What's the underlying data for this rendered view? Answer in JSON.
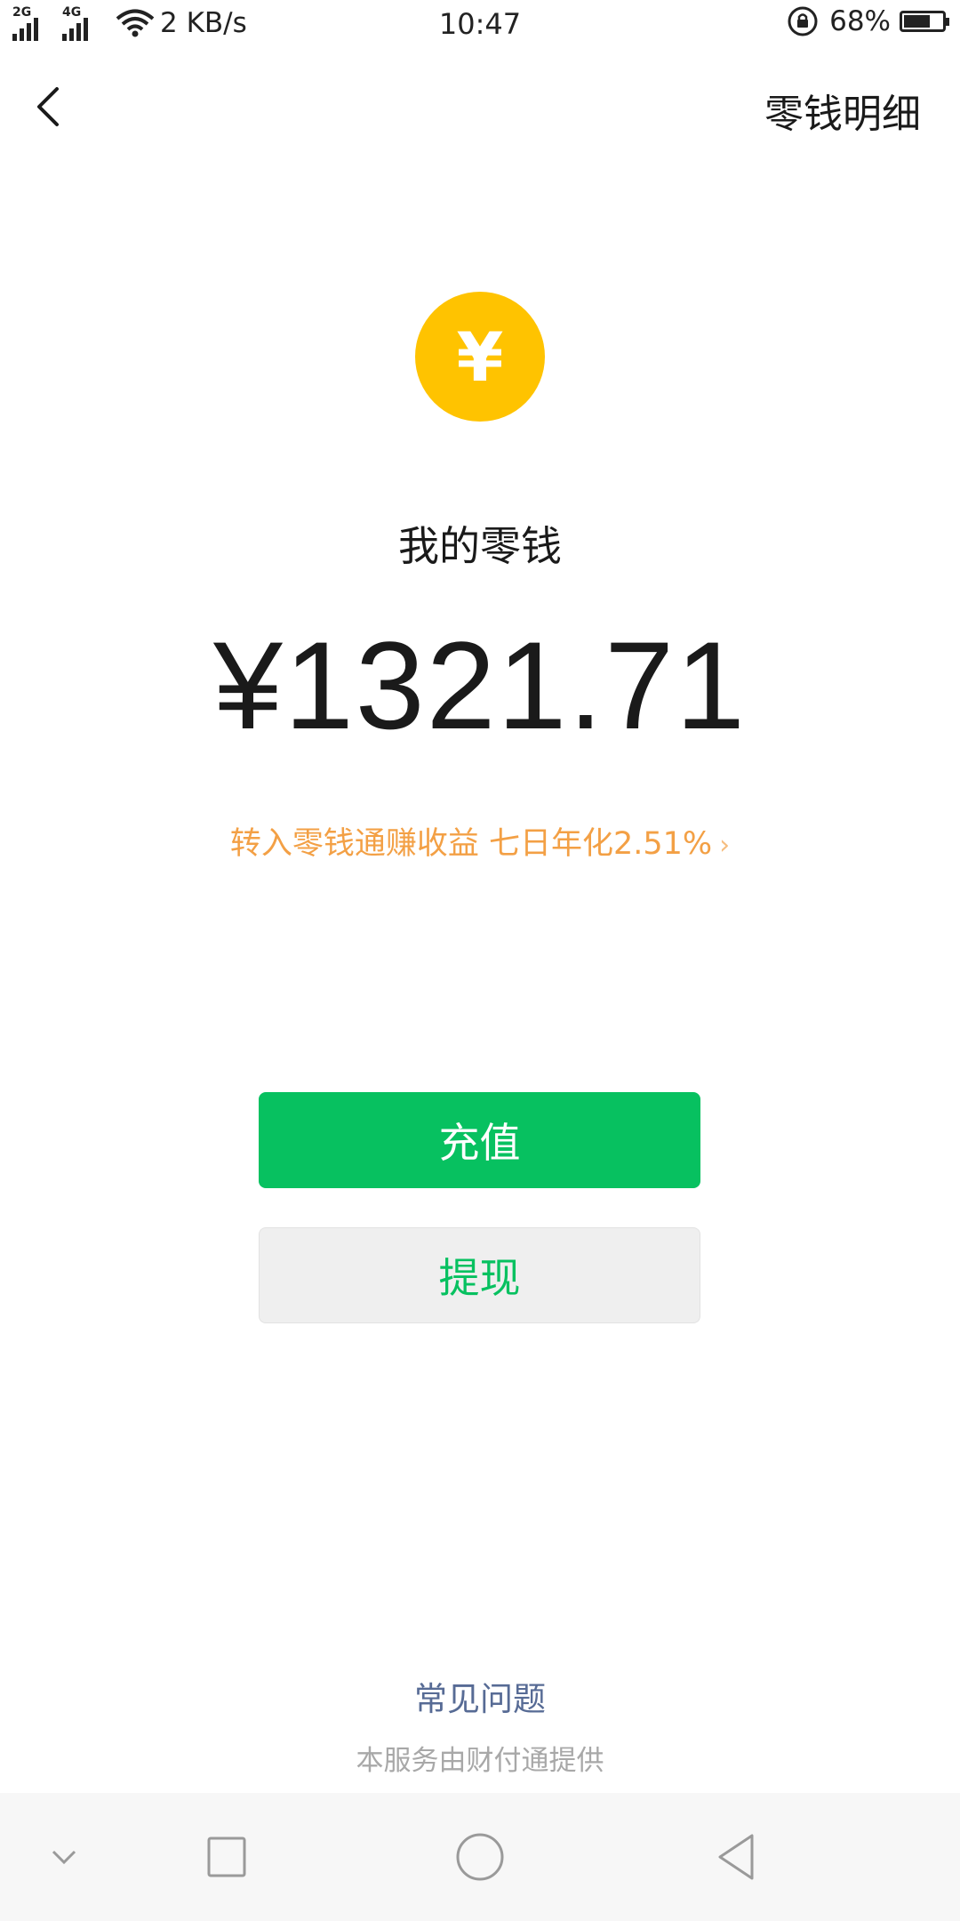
{
  "status_bar": {
    "signal_1_gen": "2G",
    "signal_2_gen": "4G",
    "net_speed": "2 KB/s",
    "time": "10:47",
    "battery_pct": "68%",
    "battery_level": 0.68
  },
  "header": {
    "back_icon": "chevron-left-icon",
    "details_label": "零钱明细"
  },
  "wallet": {
    "coin_symbol": "¥",
    "title": "我的零钱",
    "balance": "¥1321.71",
    "promo_text": "转入零钱通赚收益 七日年化2.51%",
    "promo_chevron": "›",
    "accent_yellow": "#ffc300",
    "accent_orange": "#f3a045"
  },
  "actions": {
    "recharge_label": "充值",
    "withdraw_label": "提现",
    "brand_green": "#07c160"
  },
  "footer": {
    "faq_label": "常见问题",
    "provider_text": "本服务由财付通提供",
    "link_color": "#576b95"
  },
  "nav_bar": {
    "icons": [
      "chevron-down-icon",
      "square-icon",
      "circle-icon",
      "triangle-back-icon"
    ]
  }
}
